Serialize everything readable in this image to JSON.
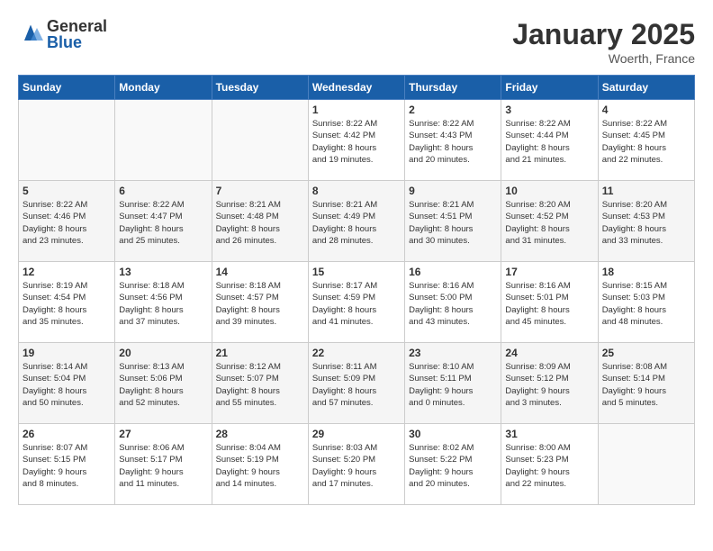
{
  "logo": {
    "general": "General",
    "blue": "Blue"
  },
  "title": "January 2025",
  "location": "Woerth, France",
  "days_of_week": [
    "Sunday",
    "Monday",
    "Tuesday",
    "Wednesday",
    "Thursday",
    "Friday",
    "Saturday"
  ],
  "weeks": [
    [
      {
        "day": "",
        "info": ""
      },
      {
        "day": "",
        "info": ""
      },
      {
        "day": "",
        "info": ""
      },
      {
        "day": "1",
        "info": "Sunrise: 8:22 AM\nSunset: 4:42 PM\nDaylight: 8 hours\nand 19 minutes."
      },
      {
        "day": "2",
        "info": "Sunrise: 8:22 AM\nSunset: 4:43 PM\nDaylight: 8 hours\nand 20 minutes."
      },
      {
        "day": "3",
        "info": "Sunrise: 8:22 AM\nSunset: 4:44 PM\nDaylight: 8 hours\nand 21 minutes."
      },
      {
        "day": "4",
        "info": "Sunrise: 8:22 AM\nSunset: 4:45 PM\nDaylight: 8 hours\nand 22 minutes."
      }
    ],
    [
      {
        "day": "5",
        "info": "Sunrise: 8:22 AM\nSunset: 4:46 PM\nDaylight: 8 hours\nand 23 minutes."
      },
      {
        "day": "6",
        "info": "Sunrise: 8:22 AM\nSunset: 4:47 PM\nDaylight: 8 hours\nand 25 minutes."
      },
      {
        "day": "7",
        "info": "Sunrise: 8:21 AM\nSunset: 4:48 PM\nDaylight: 8 hours\nand 26 minutes."
      },
      {
        "day": "8",
        "info": "Sunrise: 8:21 AM\nSunset: 4:49 PM\nDaylight: 8 hours\nand 28 minutes."
      },
      {
        "day": "9",
        "info": "Sunrise: 8:21 AM\nSunset: 4:51 PM\nDaylight: 8 hours\nand 30 minutes."
      },
      {
        "day": "10",
        "info": "Sunrise: 8:20 AM\nSunset: 4:52 PM\nDaylight: 8 hours\nand 31 minutes."
      },
      {
        "day": "11",
        "info": "Sunrise: 8:20 AM\nSunset: 4:53 PM\nDaylight: 8 hours\nand 33 minutes."
      }
    ],
    [
      {
        "day": "12",
        "info": "Sunrise: 8:19 AM\nSunset: 4:54 PM\nDaylight: 8 hours\nand 35 minutes."
      },
      {
        "day": "13",
        "info": "Sunrise: 8:18 AM\nSunset: 4:56 PM\nDaylight: 8 hours\nand 37 minutes."
      },
      {
        "day": "14",
        "info": "Sunrise: 8:18 AM\nSunset: 4:57 PM\nDaylight: 8 hours\nand 39 minutes."
      },
      {
        "day": "15",
        "info": "Sunrise: 8:17 AM\nSunset: 4:59 PM\nDaylight: 8 hours\nand 41 minutes."
      },
      {
        "day": "16",
        "info": "Sunrise: 8:16 AM\nSunset: 5:00 PM\nDaylight: 8 hours\nand 43 minutes."
      },
      {
        "day": "17",
        "info": "Sunrise: 8:16 AM\nSunset: 5:01 PM\nDaylight: 8 hours\nand 45 minutes."
      },
      {
        "day": "18",
        "info": "Sunrise: 8:15 AM\nSunset: 5:03 PM\nDaylight: 8 hours\nand 48 minutes."
      }
    ],
    [
      {
        "day": "19",
        "info": "Sunrise: 8:14 AM\nSunset: 5:04 PM\nDaylight: 8 hours\nand 50 minutes."
      },
      {
        "day": "20",
        "info": "Sunrise: 8:13 AM\nSunset: 5:06 PM\nDaylight: 8 hours\nand 52 minutes."
      },
      {
        "day": "21",
        "info": "Sunrise: 8:12 AM\nSunset: 5:07 PM\nDaylight: 8 hours\nand 55 minutes."
      },
      {
        "day": "22",
        "info": "Sunrise: 8:11 AM\nSunset: 5:09 PM\nDaylight: 8 hours\nand 57 minutes."
      },
      {
        "day": "23",
        "info": "Sunrise: 8:10 AM\nSunset: 5:11 PM\nDaylight: 9 hours\nand 0 minutes."
      },
      {
        "day": "24",
        "info": "Sunrise: 8:09 AM\nSunset: 5:12 PM\nDaylight: 9 hours\nand 3 minutes."
      },
      {
        "day": "25",
        "info": "Sunrise: 8:08 AM\nSunset: 5:14 PM\nDaylight: 9 hours\nand 5 minutes."
      }
    ],
    [
      {
        "day": "26",
        "info": "Sunrise: 8:07 AM\nSunset: 5:15 PM\nDaylight: 9 hours\nand 8 minutes."
      },
      {
        "day": "27",
        "info": "Sunrise: 8:06 AM\nSunset: 5:17 PM\nDaylight: 9 hours\nand 11 minutes."
      },
      {
        "day": "28",
        "info": "Sunrise: 8:04 AM\nSunset: 5:19 PM\nDaylight: 9 hours\nand 14 minutes."
      },
      {
        "day": "29",
        "info": "Sunrise: 8:03 AM\nSunset: 5:20 PM\nDaylight: 9 hours\nand 17 minutes."
      },
      {
        "day": "30",
        "info": "Sunrise: 8:02 AM\nSunset: 5:22 PM\nDaylight: 9 hours\nand 20 minutes."
      },
      {
        "day": "31",
        "info": "Sunrise: 8:00 AM\nSunset: 5:23 PM\nDaylight: 9 hours\nand 22 minutes."
      },
      {
        "day": "",
        "info": ""
      }
    ]
  ]
}
